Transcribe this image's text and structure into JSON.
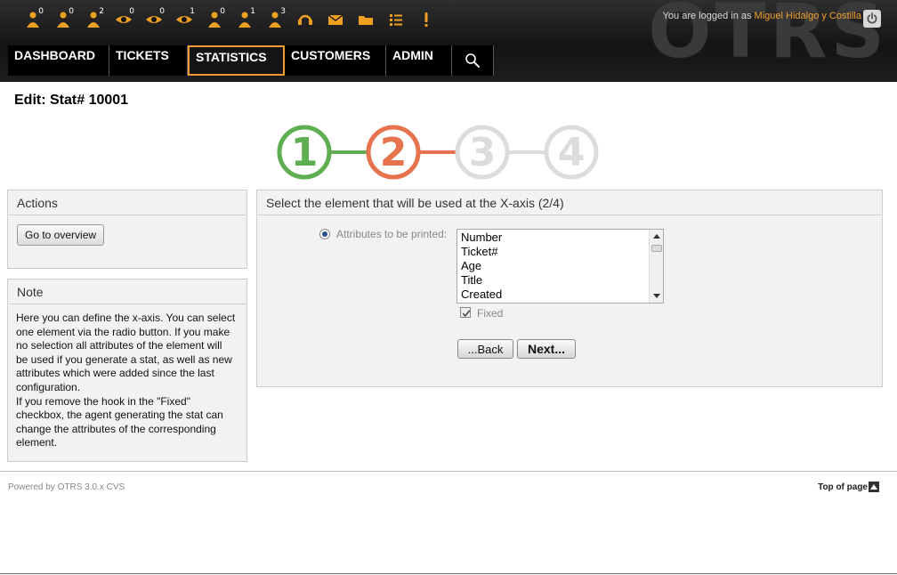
{
  "header": {
    "watermark": "OTRS",
    "login_prefix": "You are logged in as ",
    "user_name": "Miguel Hidalgo y Costilla",
    "toolbar": [
      {
        "icon": "locked-tickets-new-icon",
        "count": "0"
      },
      {
        "icon": "locked-tickets-reminder-icon",
        "count": "0"
      },
      {
        "icon": "locked-tickets-total-icon",
        "count": "2"
      },
      {
        "icon": "watched-tickets-new-icon",
        "count": "0"
      },
      {
        "icon": "watched-tickets-reminder-icon",
        "count": "0"
      },
      {
        "icon": "watched-tickets-total-icon",
        "count": "1"
      },
      {
        "icon": "responsible-new-icon",
        "count": "0"
      },
      {
        "icon": "responsible-reminder-icon",
        "count": "1"
      },
      {
        "icon": "responsible-total-icon",
        "count": "3"
      },
      {
        "icon": "phone-ticket-icon",
        "count": ""
      },
      {
        "icon": "email-ticket-icon",
        "count": ""
      },
      {
        "icon": "queue-view-icon",
        "count": ""
      },
      {
        "icon": "status-view-icon",
        "count": ""
      },
      {
        "icon": "escalation-view-icon",
        "count": ""
      }
    ]
  },
  "nav": {
    "dashboard": "DASHBOARD",
    "tickets": "TICKETS",
    "statistics": "STATISTICS",
    "customers": "CUSTOMERS",
    "admin": "ADMIN"
  },
  "page": {
    "title": "Edit: Stat# 10001"
  },
  "steps": {
    "labels": [
      "1",
      "2",
      "3",
      "4"
    ],
    "colors": {
      "done": "#5fae52",
      "current": "#e6734d",
      "pending": "#dcdcdc"
    }
  },
  "actions": {
    "heading": "Actions",
    "goto_overview": "Go to overview"
  },
  "note": {
    "heading": "Note",
    "lines": [
      "Here you can define the x-axis. You can select",
      "one element via the radio button. If you make",
      "no selection all attributes of the element will",
      "be used if you generate a stat, as well as new",
      "attributes which were added since the last",
      "configuration.",
      "If you remove the hook in the \"Fixed\"",
      "checkbox, the agent generating the stat can",
      "change the attributes of the corresponding",
      "element."
    ]
  },
  "main": {
    "heading": "Select the element that will be used at the X-axis (2/4)",
    "attributes_label": "Attributes to be printed:",
    "attributes": [
      "Number",
      "Ticket#",
      "Age",
      "Title",
      "Created"
    ],
    "fixed_label": "Fixed",
    "back": "...Back",
    "next": "Next..."
  },
  "footer": {
    "powered": "Powered by OTRS 3.0.x CVS",
    "top_of_page": "Top of page"
  },
  "colors": {
    "accent": "#f09a30",
    "icon": "#f0a020"
  }
}
